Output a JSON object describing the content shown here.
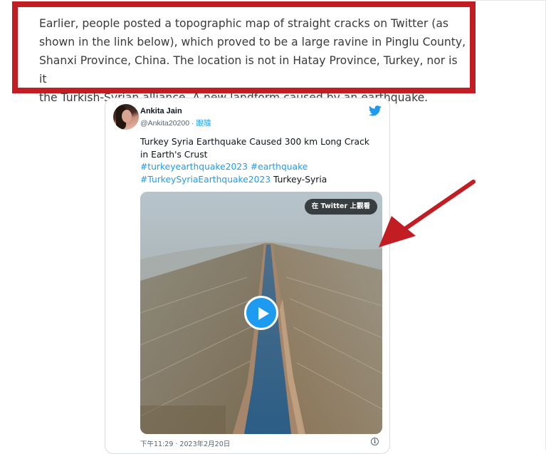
{
  "article": {
    "highlight_text": "Earlier, people posted a topographic map of straight cracks on Twitter (as shown in the link below), which proved to be a large ravine in Pinglu County, Shanxi Province, China. The location is not in Hatay Province, Turkey, nor is it the Turkish-Syrian alliance. A new landform caused by an earthquake.",
    "highlight_lines": [
      "Earlier, people posted a topographic map of straight cracks on Twitter (as",
      "shown in the link below), which proved to be a large ravine in Pinglu County,",
      "Shanxi Province, China. The location is not in Hatay Province, Turkey, nor is it",
      "the Turkish-Syrian alliance. A new landform caused by an earthquake."
    ],
    "highlight_border_color": "#c11d22"
  },
  "tweet": {
    "author_name": "Ankita Jain",
    "author_handle": "@Ankita20200",
    "separator": " · ",
    "follow_label": "跟隨",
    "text_lines": [
      "Turkey Syria Earthquake Caused 300 km Long Crack",
      "in Earth's Crust"
    ],
    "hashtags_line1": [
      "#turkeyearthquake2023",
      "#earthquake"
    ],
    "hashtag_line2": "#TurkeySyriaEarthquake2023",
    "trailing_text": " Turkey-Syria",
    "media": {
      "watch_button_label": "在 Twitter 上觀看",
      "play_icon": "play-icon"
    },
    "timestamp": "下午11:29 · 2023年2月20日",
    "info_icon_glyph": "i",
    "brand_icon": "twitter-bird-icon",
    "link_color": "#1d9bf0"
  },
  "annotation": {
    "arrow_color": "#c11d22",
    "arrow_icon": "arrow-pointer-icon"
  }
}
